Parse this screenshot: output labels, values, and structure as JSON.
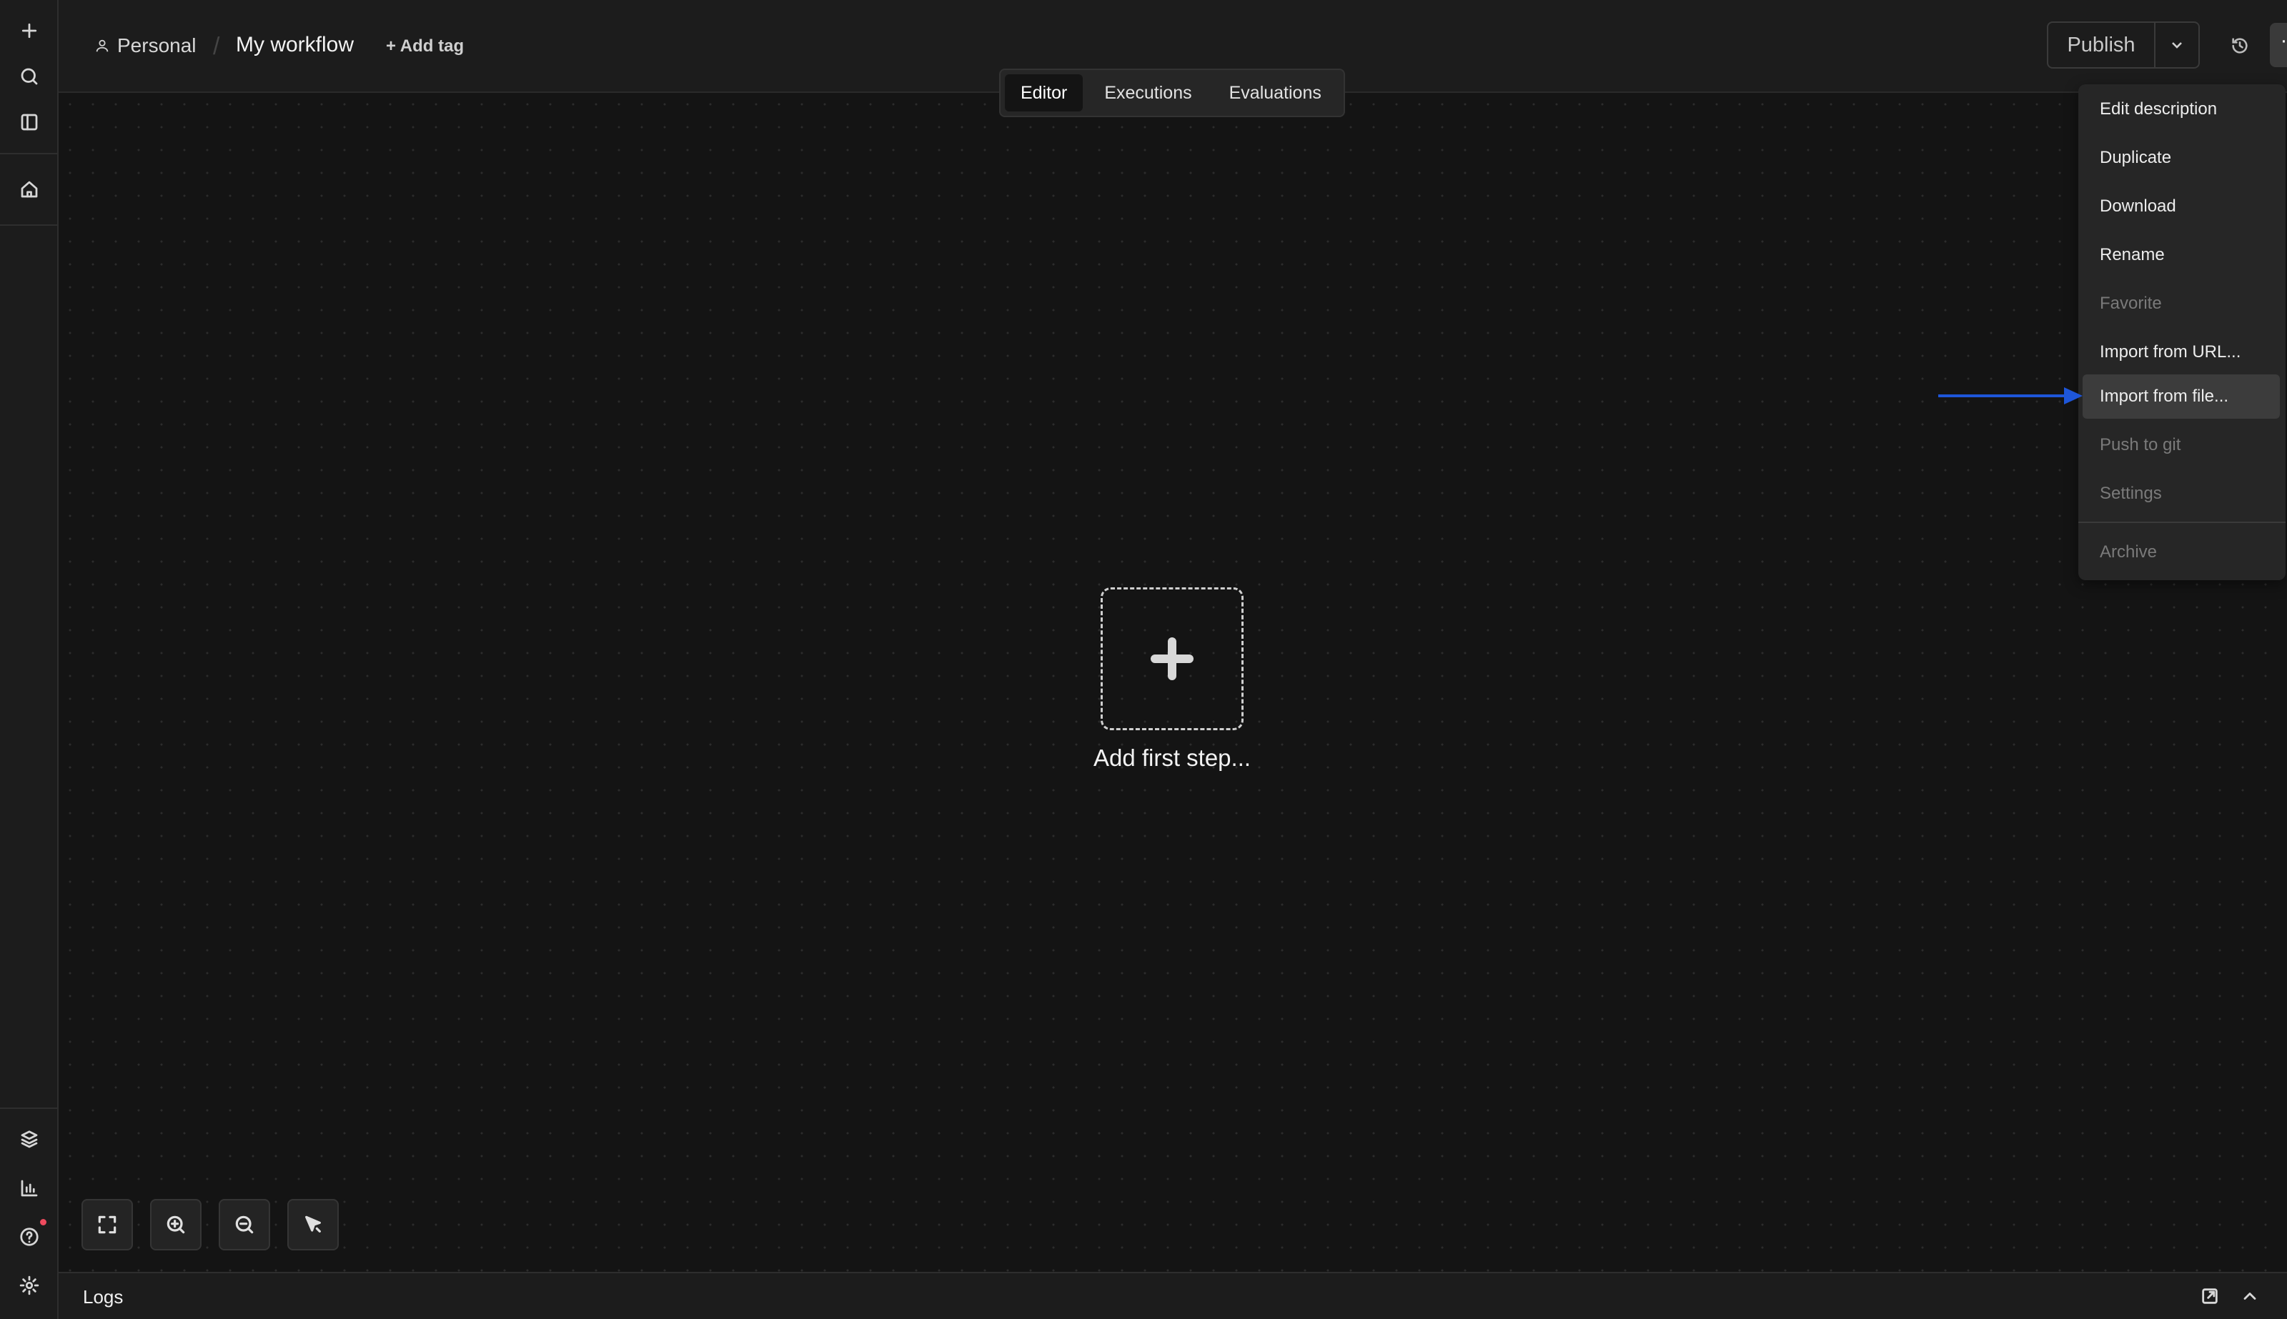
{
  "breadcrumb": {
    "project": "Personal",
    "workflow_name": "My workflow",
    "add_tag": "+ Add tag"
  },
  "tabs": [
    {
      "label": "Editor",
      "active": true
    },
    {
      "label": "Executions",
      "active": false
    },
    {
      "label": "Evaluations",
      "active": false
    }
  ],
  "actions": {
    "publish": "Publish",
    "more": "···"
  },
  "menu": {
    "items": [
      {
        "label": "Edit description",
        "disabled": false
      },
      {
        "label": "Duplicate",
        "disabled": false
      },
      {
        "label": "Download",
        "disabled": false
      },
      {
        "label": "Rename",
        "disabled": false
      },
      {
        "label": "Favorite",
        "disabled": true
      },
      {
        "label": "Import from URL...",
        "disabled": false
      },
      {
        "label": "Import from file...",
        "disabled": false,
        "highlighted": true
      },
      {
        "label": "Push to git",
        "disabled": true
      },
      {
        "label": "Settings",
        "disabled": true
      },
      {
        "label": "Archive",
        "disabled": true
      }
    ]
  },
  "canvas": {
    "add_first_step": "Add first step..."
  },
  "logs": {
    "label": "Logs"
  },
  "rail_icons": [
    "plus-icon",
    "search-icon",
    "sidebar-toggle-icon",
    "home-icon",
    "templates-icon",
    "insights-icon",
    "help-icon",
    "settings-icon"
  ],
  "zoom_controls": [
    "fit-view-icon",
    "zoom-in-icon",
    "zoom-out-icon",
    "tidy-up-icon"
  ],
  "colors": {
    "background": "#141414",
    "panel": "#1c1c1c",
    "menu": "#262626",
    "annotation_arrow": "#1e56d9",
    "notification_dot": "#ef4b5e"
  }
}
